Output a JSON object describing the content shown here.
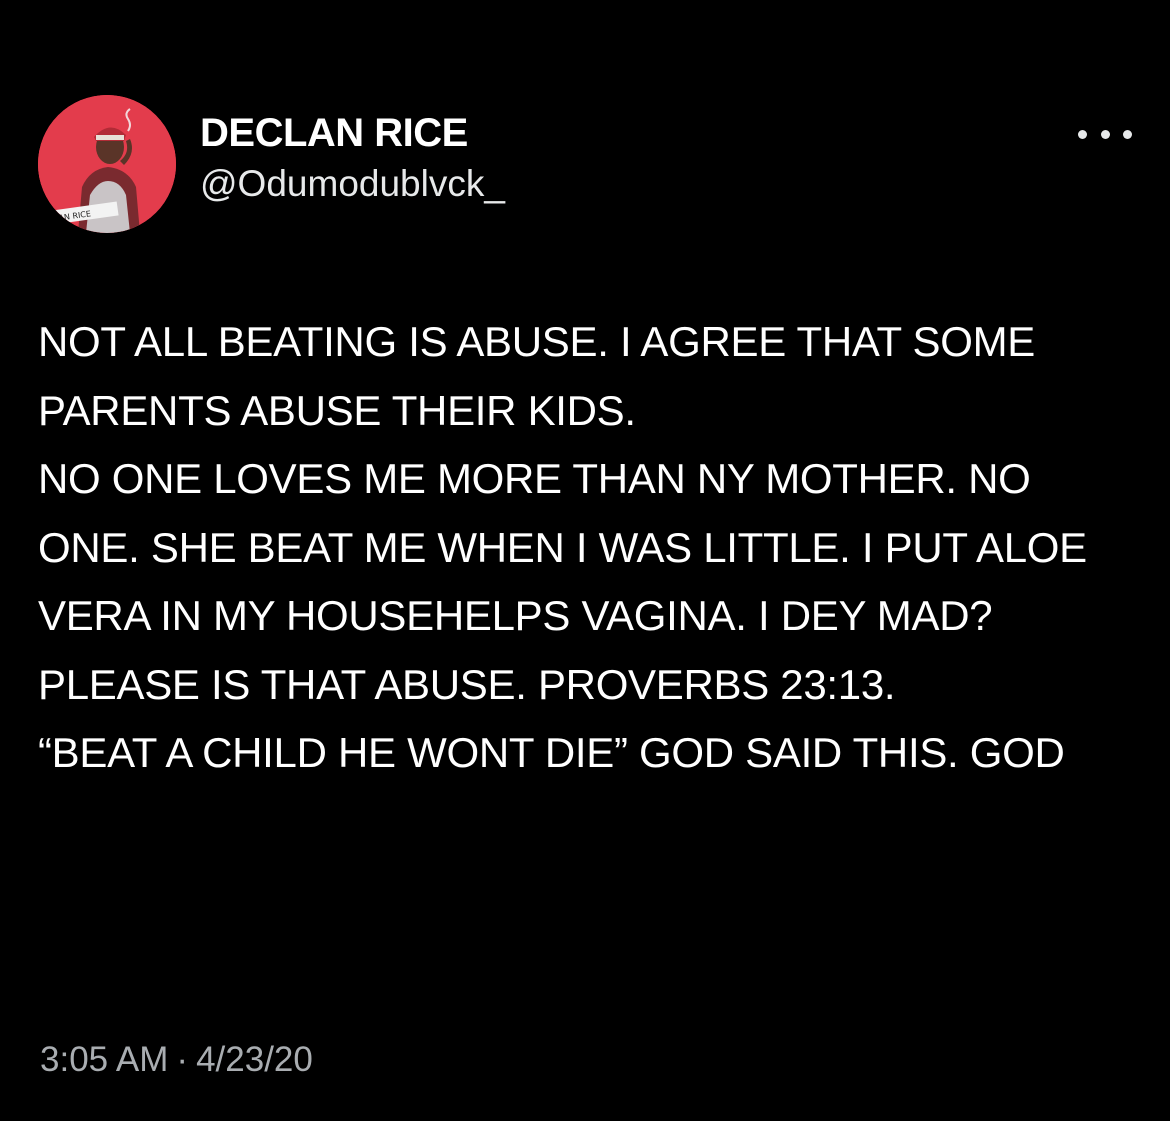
{
  "user": {
    "display_name": "DECLAN RICE",
    "handle": "@Odumodublvck_",
    "avatar_caption": "CLAN RICE"
  },
  "tweet": {
    "text": "NOT ALL BEATING IS ABUSE. I AGREE THAT SOME PARENTS ABUSE THEIR KIDS.\nNO ONE LOVES ME MORE THAN NY MOTHER. NO ONE. SHE BEAT ME WHEN I WAS LITTLE. I PUT ALOE VERA IN MY HOUSEHELPS VAGINA. I DEY MAD?\nPLEASE IS THAT ABUSE. PROVERBS 23:13.\n“BEAT A CHILD HE WONT DIE” GOD SAID THIS. GOD",
    "time": "3:05 AM",
    "separator": "·",
    "date": "4/23/20"
  },
  "icons": {
    "more": "more-options-icon"
  },
  "colors": {
    "background": "#000000",
    "text_primary": "#ffffff",
    "text_secondary": "#a9adb1",
    "avatar_bg": "#e7384a"
  }
}
